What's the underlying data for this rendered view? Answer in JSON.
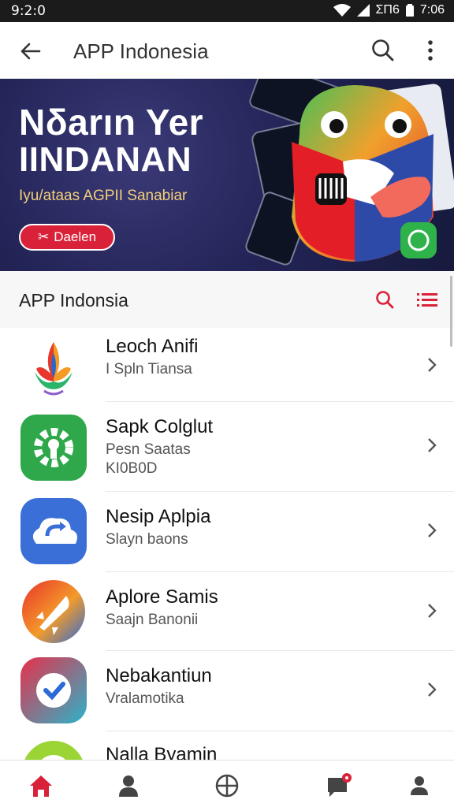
{
  "status_bar": {
    "time_left": "9:2:0",
    "network": "ΣΠ6",
    "time_right": "7:06"
  },
  "app_bar": {
    "title": "APP Indonesia"
  },
  "banner": {
    "title_line1": "Nδarın Yer",
    "title_line2": "IINDANAN",
    "subtitle": "Iyu/ataas AGPII Sanabiar",
    "cta_label": "Daelen"
  },
  "section": {
    "title": "APP Indonsia"
  },
  "apps": [
    {
      "name": "Leoch Anifi",
      "subtitle": "I Spln Tiansa",
      "extra": "",
      "icon": "flame-flower-icon"
    },
    {
      "name": "Sapk Colglut",
      "subtitle": "Pesn Saatas",
      "extra": "KI0B0D",
      "icon": "gear-lock-icon"
    },
    {
      "name": "Nesip Aplpia",
      "subtitle": "Slayn baons",
      "extra": "",
      "icon": "cloud-refresh-icon"
    },
    {
      "name": "Aplore Samis",
      "subtitle": "Saajn Banonii",
      "extra": "",
      "icon": "rocket-icon"
    },
    {
      "name": "Nebakantiun",
      "subtitle": "Vralamotika",
      "extra": "",
      "icon": "check-badge-icon"
    },
    {
      "name": "Nalla Byamin",
      "subtitle": "",
      "extra": "",
      "icon": "green-circle-icon"
    }
  ],
  "bottom_nav": [
    {
      "name": "home",
      "icon": "home-icon",
      "active": true
    },
    {
      "name": "profile",
      "icon": "person-bust-icon",
      "active": false
    },
    {
      "name": "explore",
      "icon": "globe-icon",
      "active": false
    },
    {
      "name": "messages",
      "icon": "chat-badge-icon",
      "active": false
    },
    {
      "name": "account",
      "icon": "person-icon",
      "active": false
    }
  ],
  "colors": {
    "accent": "#d9223a",
    "banner_bg": "#232457",
    "status_bar": "#1b1b1b"
  }
}
